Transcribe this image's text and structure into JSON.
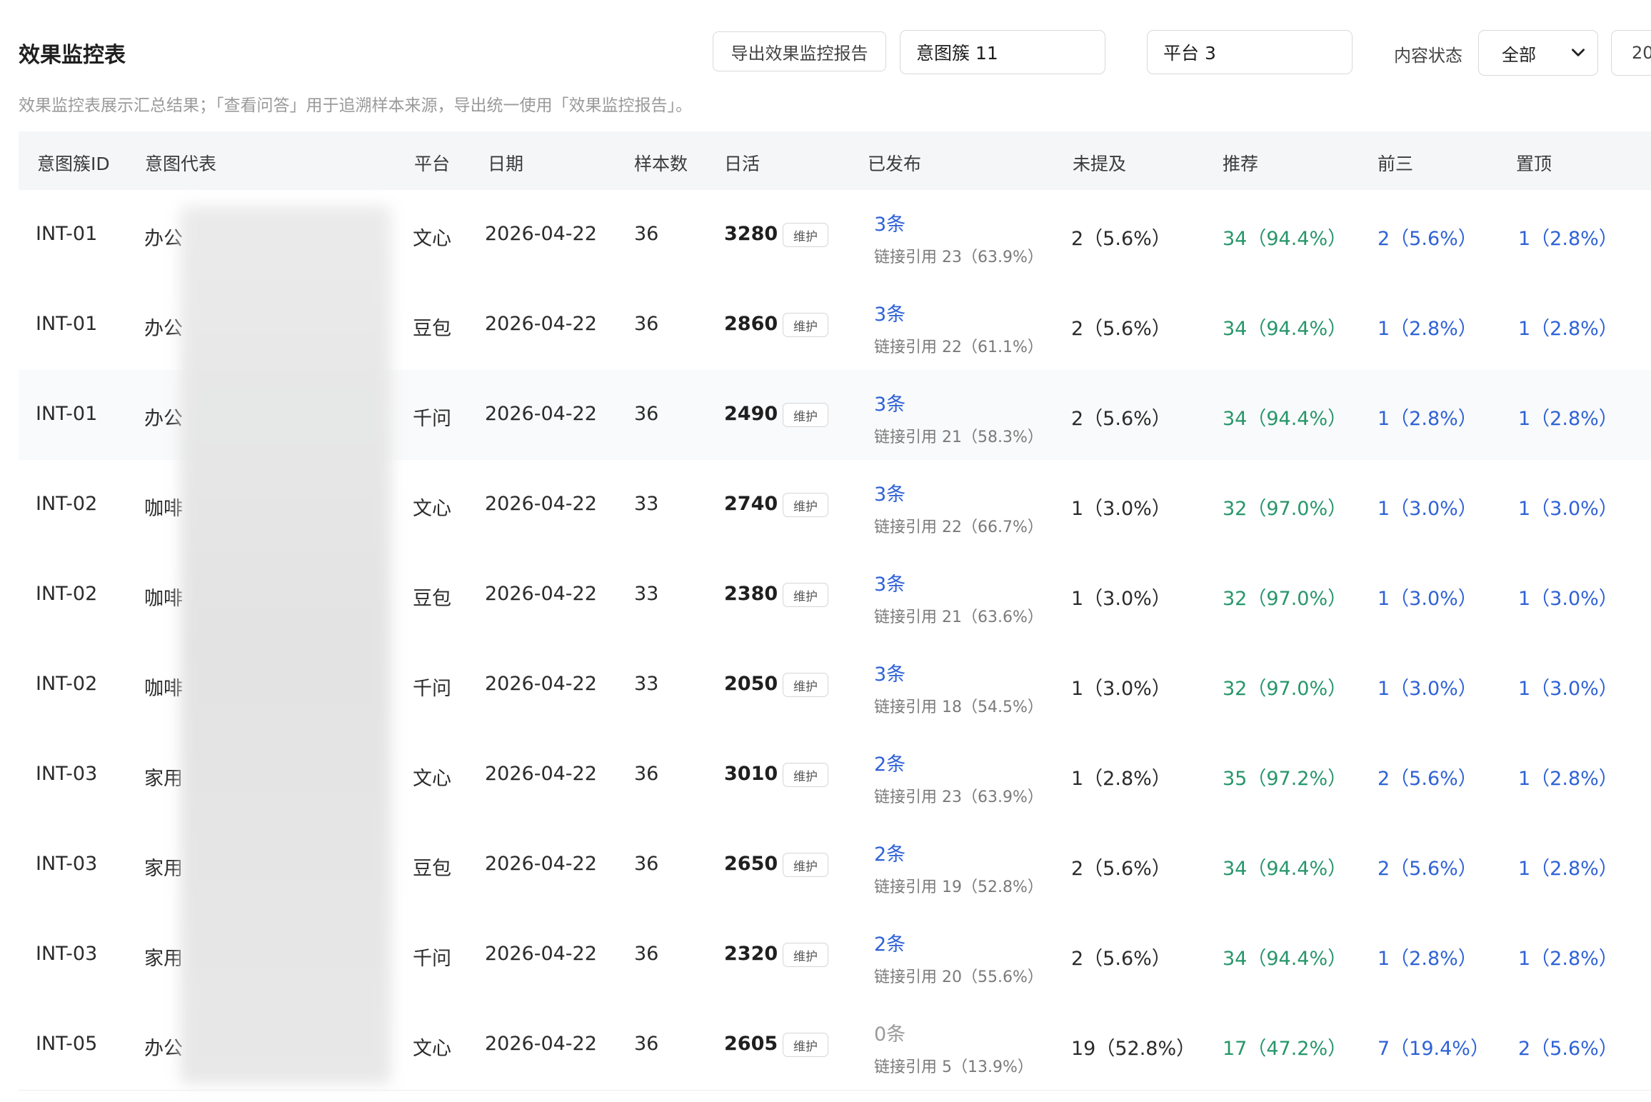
{
  "header": {
    "title": "效果监控表",
    "description": "效果监控表展示汇总结果；「查看问答」用于追溯样本来源，导出统一使用「效果监控报告」。",
    "export_button": "导出效果监控报告",
    "intent_filter": "意图簇 11",
    "platform_filter": "平台 3",
    "content_status_label": "内容状态",
    "content_status_value": "全部",
    "extra_select_value": "20"
  },
  "table": {
    "columns": [
      "意图簇ID",
      "意图代表",
      "平台",
      "日期",
      "样本数",
      "日活",
      "已发布",
      "未提及",
      "推荐",
      "前三",
      "置顶"
    ],
    "rows": [
      {
        "id": "INT-01",
        "rep": "办公",
        "platform": "文心",
        "date": "2026-04-22",
        "samples": "36",
        "dau": "3280",
        "tag": "维护",
        "published": "3条",
        "link_ref": "链接引用 23（63.9%）",
        "unmentioned": "2（5.6%）",
        "recommend": "34（94.4%）",
        "top3": "2（5.6%）",
        "pinned": "1（2.8%）"
      },
      {
        "id": "INT-01",
        "rep": "办公",
        "platform": "豆包",
        "date": "2026-04-22",
        "samples": "36",
        "dau": "2860",
        "tag": "维护",
        "published": "3条",
        "link_ref": "链接引用 22（61.1%）",
        "unmentioned": "2（5.6%）",
        "recommend": "34（94.4%）",
        "top3": "1（2.8%）",
        "pinned": "1（2.8%）"
      },
      {
        "id": "INT-01",
        "rep": "办公",
        "platform": "千问",
        "date": "2026-04-22",
        "samples": "36",
        "dau": "2490",
        "tag": "维护",
        "published": "3条",
        "link_ref": "链接引用 21（58.3%）",
        "unmentioned": "2（5.6%）",
        "recommend": "34（94.4%）",
        "top3": "1（2.8%）",
        "pinned": "1（2.8%）"
      },
      {
        "id": "INT-02",
        "rep": "咖啡",
        "platform": "文心",
        "date": "2026-04-22",
        "samples": "33",
        "dau": "2740",
        "tag": "维护",
        "published": "3条",
        "link_ref": "链接引用 22（66.7%）",
        "unmentioned": "1（3.0%）",
        "recommend": "32（97.0%）",
        "top3": "1（3.0%）",
        "pinned": "1（3.0%）"
      },
      {
        "id": "INT-02",
        "rep": "咖啡",
        "platform": "豆包",
        "date": "2026-04-22",
        "samples": "33",
        "dau": "2380",
        "tag": "维护",
        "published": "3条",
        "link_ref": "链接引用 21（63.6%）",
        "unmentioned": "1（3.0%）",
        "recommend": "32（97.0%）",
        "top3": "1（3.0%）",
        "pinned": "1（3.0%）"
      },
      {
        "id": "INT-02",
        "rep": "咖啡",
        "platform": "千问",
        "date": "2026-04-22",
        "samples": "33",
        "dau": "2050",
        "tag": "维护",
        "published": "3条",
        "link_ref": "链接引用 18（54.5%）",
        "unmentioned": "1（3.0%）",
        "recommend": "32（97.0%）",
        "top3": "1（3.0%）",
        "pinned": "1（3.0%）"
      },
      {
        "id": "INT-03",
        "rep": "家用",
        "platform": "文心",
        "date": "2026-04-22",
        "samples": "36",
        "dau": "3010",
        "tag": "维护",
        "published": "2条",
        "link_ref": "链接引用 23（63.9%）",
        "unmentioned": "1（2.8%）",
        "recommend": "35（97.2%）",
        "top3": "2（5.6%）",
        "pinned": "1（2.8%）"
      },
      {
        "id": "INT-03",
        "rep": "家用",
        "platform": "豆包",
        "date": "2026-04-22",
        "samples": "36",
        "dau": "2650",
        "tag": "维护",
        "published": "2条",
        "link_ref": "链接引用 19（52.8%）",
        "unmentioned": "2（5.6%）",
        "recommend": "34（94.4%）",
        "top3": "2（5.6%）",
        "pinned": "1（2.8%）"
      },
      {
        "id": "INT-03",
        "rep": "家用",
        "platform": "千问",
        "date": "2026-04-22",
        "samples": "36",
        "dau": "2320",
        "tag": "维护",
        "published": "2条",
        "link_ref": "链接引用 20（55.6%）",
        "unmentioned": "2（5.6%）",
        "recommend": "34（94.4%）",
        "top3": "1（2.8%）",
        "pinned": "1（2.8%）"
      },
      {
        "id": "INT-05",
        "rep": "办公",
        "platform": "文心",
        "date": "2026-04-22",
        "samples": "36",
        "dau": "2605",
        "tag": "维护",
        "published": "0条",
        "link_ref": "链接引用 5（13.9%）",
        "unmentioned": "19（52.8%）",
        "recommend": "17（47.2%）",
        "top3": "7（19.4%）",
        "pinned": "2（5.6%）"
      }
    ]
  },
  "colors": {
    "link_blue": "#2f62d6",
    "recommend_green": "#27966a",
    "muted_gray": "#9a9a9a"
  }
}
